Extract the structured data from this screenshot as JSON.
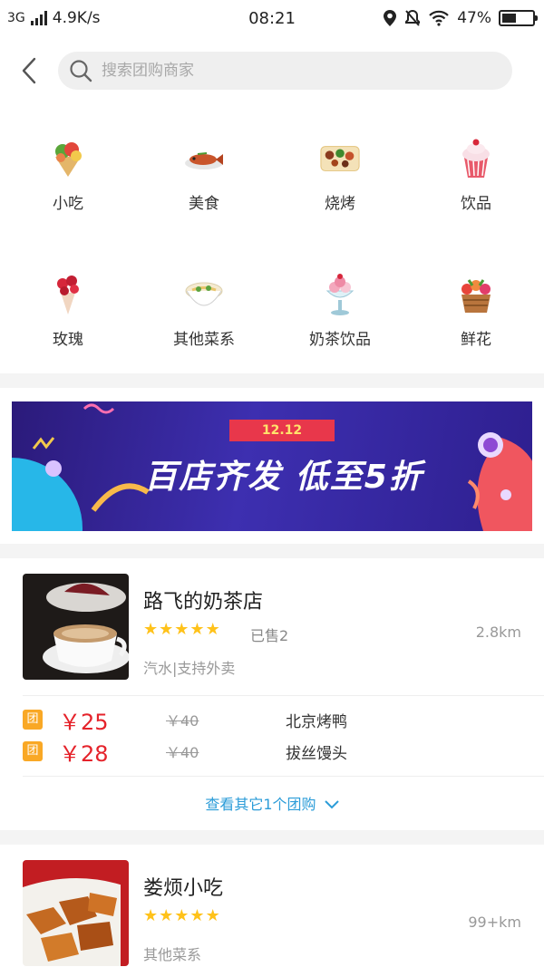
{
  "status_bar": {
    "network": "3G",
    "speed": "4.9K/s",
    "time": "08:21",
    "battery": "47%",
    "battery_level": 0.47
  },
  "header": {
    "back_icon": "chevron-left-icon",
    "search_placeholder": "搜索团购商家"
  },
  "categories": [
    {
      "label": "小吃",
      "icon": "wrap-icon"
    },
    {
      "label": "美食",
      "icon": "fish-dish-icon"
    },
    {
      "label": "烧烤",
      "icon": "bbq-platter-icon"
    },
    {
      "label": "饮品",
      "icon": "cupcake-icon"
    },
    {
      "label": "玫瑰",
      "icon": "rose-bouquet-icon"
    },
    {
      "label": "其他菜系",
      "icon": "noodle-bowl-icon"
    },
    {
      "label": "奶茶饮品",
      "icon": "sundae-icon"
    },
    {
      "label": "鲜花",
      "icon": "flower-basket-icon"
    }
  ],
  "banner": {
    "date": "12.12",
    "headline": "百店齐发  低至5折"
  },
  "shops": [
    {
      "name": "路飞的奶茶店",
      "rating": 5,
      "sold": "已售2",
      "distance": "2.8km",
      "tags": "汽水|支持外卖",
      "deals": [
        {
          "badge": "团",
          "price": "￥25",
          "original": "￥40",
          "name": "北京烤鸭"
        },
        {
          "badge": "团",
          "price": "￥28",
          "original": "￥40",
          "name": "拔丝馒头"
        }
      ],
      "more": "查看其它1个团购"
    },
    {
      "name": "娄烦小吃",
      "rating": 5,
      "distance": "99+km",
      "tags": "其他菜系"
    }
  ],
  "colors": {
    "accent_price": "#e5232b",
    "star": "#ffc21a",
    "link": "#2b9cd8",
    "badge": "#f9a825"
  }
}
